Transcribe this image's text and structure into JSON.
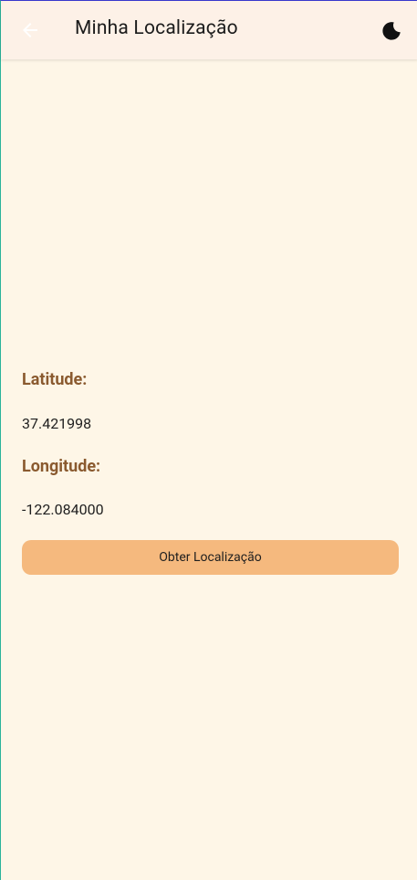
{
  "appbar": {
    "title": "Minha Localização",
    "back_icon": "arrow-left-icon",
    "theme_icon": "moon-icon"
  },
  "location": {
    "latitude_label": "Latitude:",
    "latitude_value": "37.421998",
    "longitude_label": "Longitude:",
    "longitude_value": "-122.084000"
  },
  "actions": {
    "get_location_label": "Obter Localização"
  },
  "colors": {
    "background": "#fef6e7",
    "appbar": "#fdf1e7",
    "label": "#8a5a2f",
    "button": "#f5b97e"
  }
}
